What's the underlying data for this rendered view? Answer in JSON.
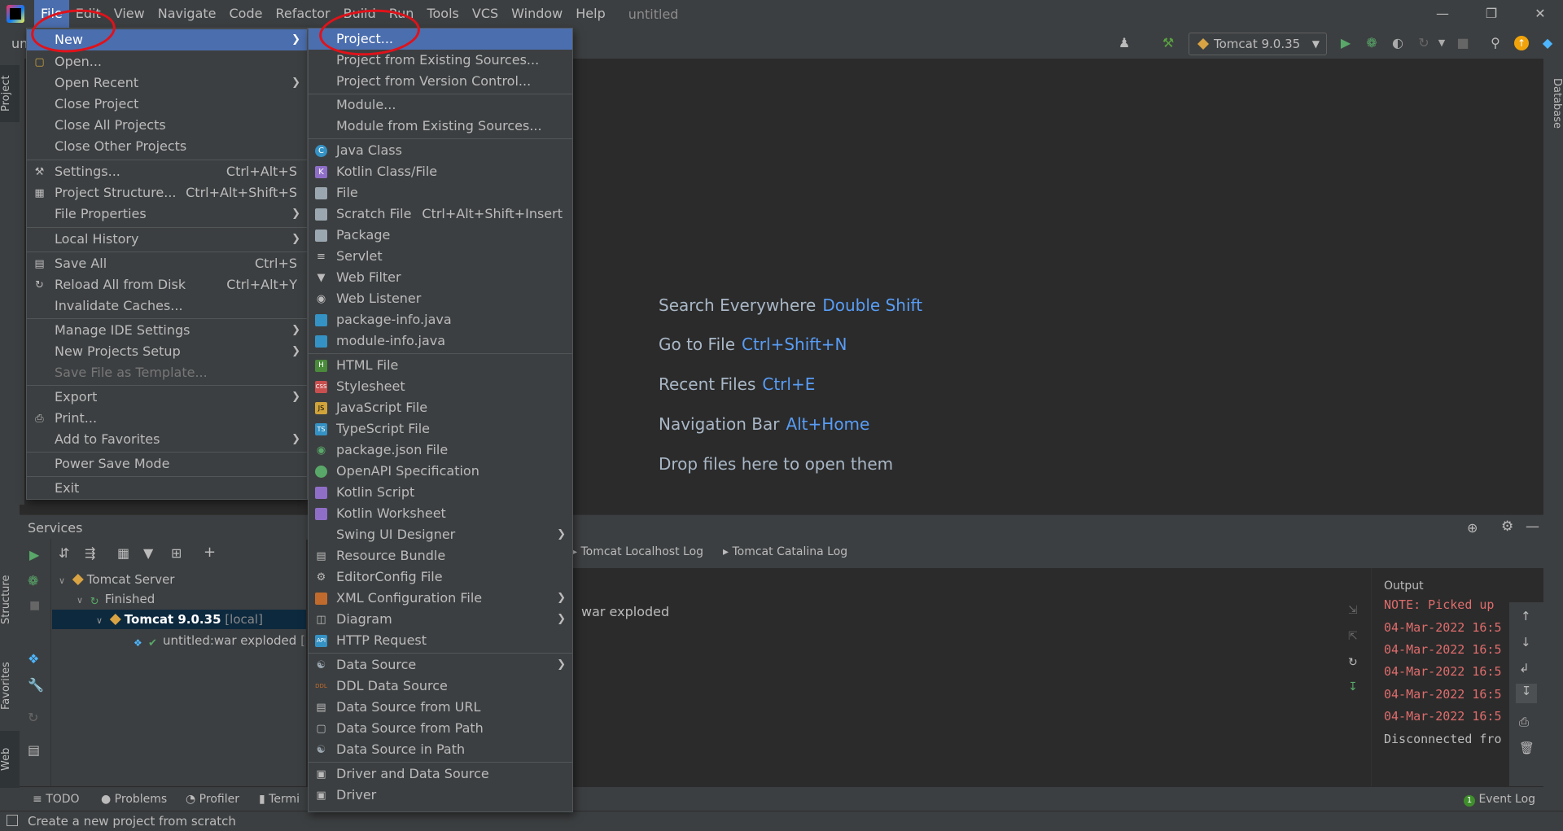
{
  "menubar": {
    "items": [
      "File",
      "Edit",
      "View",
      "Navigate",
      "Code",
      "Refactor",
      "Build",
      "Run",
      "Tools",
      "VCS",
      "Window",
      "Help"
    ],
    "window_title": "untitled"
  },
  "toolbar": {
    "project_crumb": "un",
    "run_config": "Tomcat 9.0.35"
  },
  "left_stripe": {
    "project": "Project",
    "structure": "Structure",
    "favorites": "Favorites",
    "web": "Web"
  },
  "right_stripe": {
    "database": "Database"
  },
  "welcome": [
    {
      "label": "Search Everywhere",
      "key": "Double Shift"
    },
    {
      "label": "Go to File",
      "key": "Ctrl+Shift+N"
    },
    {
      "label": "Recent Files",
      "key": "Ctrl+E"
    },
    {
      "label": "Navigation Bar",
      "key": "Alt+Home"
    },
    {
      "label": "Drop files here to open them",
      "key": ""
    }
  ],
  "file_menu": {
    "new": "New",
    "open": "Open...",
    "open_recent": "Open Recent",
    "close_project": "Close Project",
    "close_all": "Close All Projects",
    "close_other": "Close Other Projects",
    "settings": "Settings...",
    "settings_sc": "Ctrl+Alt+S",
    "project_structure": "Project Structure...",
    "project_structure_sc": "Ctrl+Alt+Shift+S",
    "file_properties": "File Properties",
    "local_history": "Local History",
    "save_all": "Save All",
    "save_all_sc": "Ctrl+S",
    "reload": "Reload All from Disk",
    "reload_sc": "Ctrl+Alt+Y",
    "invalidate": "Invalidate Caches...",
    "manage_ide": "Manage IDE Settings",
    "new_projects_setup": "New Projects Setup",
    "save_template": "Save File as Template...",
    "export": "Export",
    "print": "Print...",
    "favorites": "Add to Favorites",
    "power_save": "Power Save Mode",
    "exit": "Exit"
  },
  "new_menu": {
    "project": "Project...",
    "from_existing": "Project from Existing Sources...",
    "from_vcs": "Project from Version Control...",
    "module": "Module...",
    "module_existing": "Module from Existing Sources...",
    "java_class": "Java Class",
    "kotlin_class": "Kotlin Class/File",
    "file": "File",
    "scratch": "Scratch File",
    "scratch_sc": "Ctrl+Alt+Shift+Insert",
    "package": "Package",
    "servlet": "Servlet",
    "web_filter": "Web Filter",
    "web_listener": "Web Listener",
    "package_info": "package-info.java",
    "module_info": "module-info.java",
    "html": "HTML File",
    "stylesheet": "Stylesheet",
    "js": "JavaScript File",
    "ts": "TypeScript File",
    "package_json": "package.json File",
    "openapi": "OpenAPI Specification",
    "kotlin_script": "Kotlin Script",
    "kotlin_worksheet": "Kotlin Worksheet",
    "swing": "Swing UI Designer",
    "resource_bundle": "Resource Bundle",
    "editorconfig": "EditorConfig File",
    "xml_config": "XML Configuration File",
    "diagram": "Diagram",
    "http_request": "HTTP Request",
    "data_source": "Data Source",
    "ddl": "DDL Data Source",
    "ds_url": "Data Source from URL",
    "ds_path": "Data Source from Path",
    "ds_in_path": "Data Source in Path",
    "driver_ds": "Driver and Data Source",
    "driver": "Driver"
  },
  "services": {
    "title": "Services",
    "tree": {
      "server": "Tomcat Server",
      "finished": "Finished",
      "instance": "Tomcat 9.0.35",
      "instance_tag": "[local]",
      "artifact": "untitled:war exploded",
      "artifact_tail": "["
    },
    "log_tabs": [
      "Tomcat Localhost Log",
      "Tomcat Catalina Log"
    ],
    "deployment_line": "war exploded",
    "output_title": "Output",
    "output_lines": [
      "NOTE: Picked up",
      "04-Mar-2022 16:5",
      "04-Mar-2022 16:5",
      "04-Mar-2022 16:5",
      "04-Mar-2022 16:5",
      "04-Mar-2022 16:5",
      "Disconnected fro"
    ]
  },
  "bottom_tabs": {
    "todo": "TODO",
    "problems": "Problems",
    "profiler": "Profiler",
    "terminal": "Termi",
    "event_log": "Event Log",
    "event_count": "1"
  },
  "status": {
    "text": "Create a new project from scratch"
  },
  "colors": {
    "accent": "#4b6eaf",
    "link": "#589df6",
    "annotation": "#e0121a",
    "log_error": "#e06c6c"
  }
}
